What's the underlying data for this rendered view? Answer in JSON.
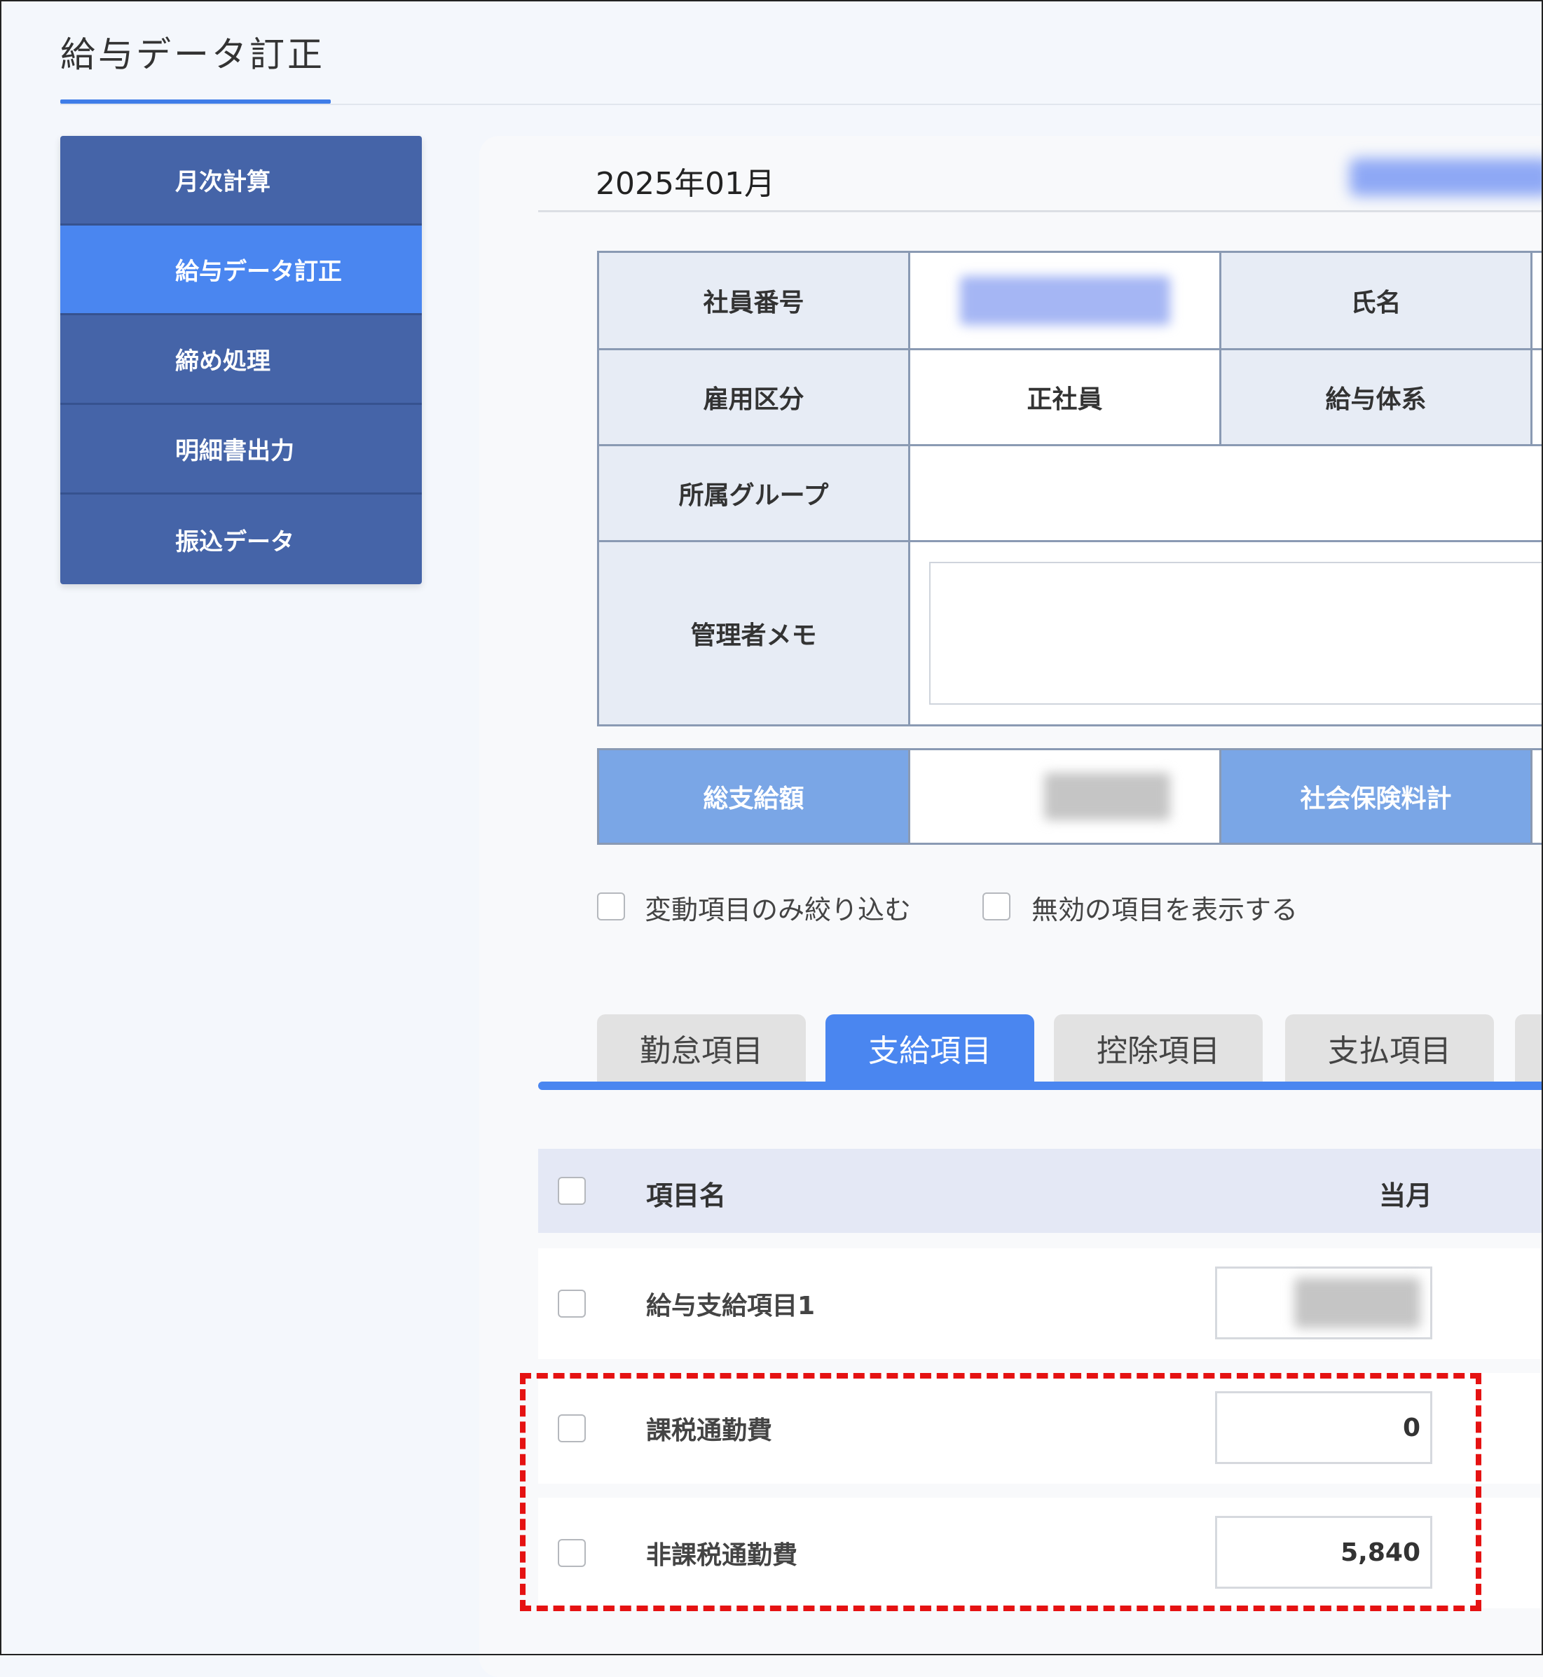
{
  "page": {
    "title": "給与データ訂正"
  },
  "sidebar": {
    "items": [
      {
        "label": "月次計算",
        "active": false
      },
      {
        "label": "給与データ訂正",
        "active": true
      },
      {
        "label": "締め処理",
        "active": false
      },
      {
        "label": "明細書出力",
        "active": false
      },
      {
        "label": "振込データ",
        "active": false
      }
    ]
  },
  "header": {
    "month": "2025年01月"
  },
  "info": {
    "employee_number_label": "社員番号",
    "name_label": "氏名",
    "employment_type_label": "雇用区分",
    "employment_type_value": "正社員",
    "salary_system_label": "給与体系",
    "group_label": "所属グループ",
    "memo_label": "管理者メモ"
  },
  "totals": {
    "gross_pay_label": "総支給額",
    "social_insurance_label": "社会保険料計"
  },
  "options": {
    "filter_variable": "変動項目のみ絞り込む",
    "show_invalid": "無効の項目を表示する"
  },
  "tabs": [
    {
      "label": "勤怠項目",
      "active": false
    },
    {
      "label": "支給項目",
      "active": true
    },
    {
      "label": "控除項目",
      "active": false
    },
    {
      "label": "支払項目",
      "active": false
    }
  ],
  "table": {
    "headers": {
      "item_name": "項目名",
      "current_month": "当月"
    },
    "rows": [
      {
        "name": "給与支給項目1",
        "value": ""
      },
      {
        "name": "課税通勤費",
        "value": "0"
      },
      {
        "name": "非課税通勤費",
        "value": "5,840"
      }
    ]
  },
  "colors": {
    "accent": "#4a86f0",
    "nav": "#4564a8",
    "highlight": "#e51212"
  }
}
